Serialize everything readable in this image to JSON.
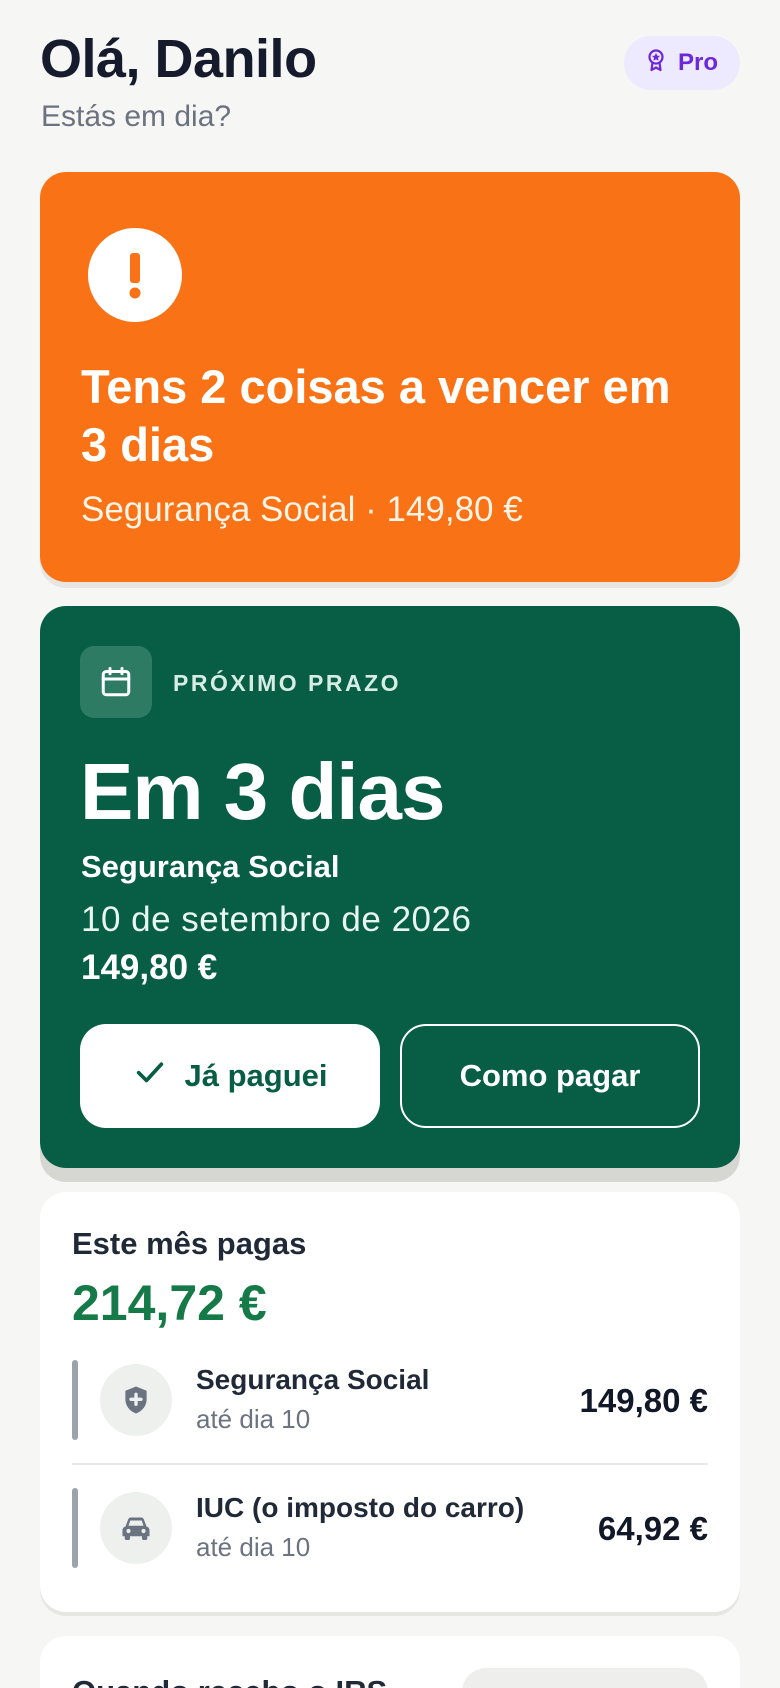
{
  "header": {
    "greeting": "Olá, Danilo",
    "subtitle": "Estás em dia?",
    "badge_label": "Pro",
    "badge_icon": "award-icon"
  },
  "alert": {
    "icon": "exclamation-icon",
    "title": "Tens 2 coisas a vencer em 3 dias",
    "subtitle": "Segurança Social · 149,80 €",
    "color": "#f97316"
  },
  "deadline": {
    "icon": "calendar-icon",
    "label": "PRÓXIMO PRAZO",
    "days": "Em 3 dias",
    "name": "Segurança Social",
    "date": "10 de setembro de 2026",
    "amount": "149,80 €",
    "paid_button": "Já paguei",
    "paid_icon": "check-icon",
    "how_button": "Como pagar",
    "color": "#075e45"
  },
  "month": {
    "label": "Este mês pagas",
    "total": "214,72 €",
    "items": [
      {
        "icon": "shield-icon",
        "name": "Segurança Social",
        "due": "até dia 10",
        "amount": "149,80 €"
      },
      {
        "icon": "car-icon",
        "name": "IUC (o imposto do carro)",
        "due": "até dia 10",
        "amount": "64,92 €"
      }
    ]
  },
  "next_section": {
    "title": "Quando recebo o IRS"
  }
}
